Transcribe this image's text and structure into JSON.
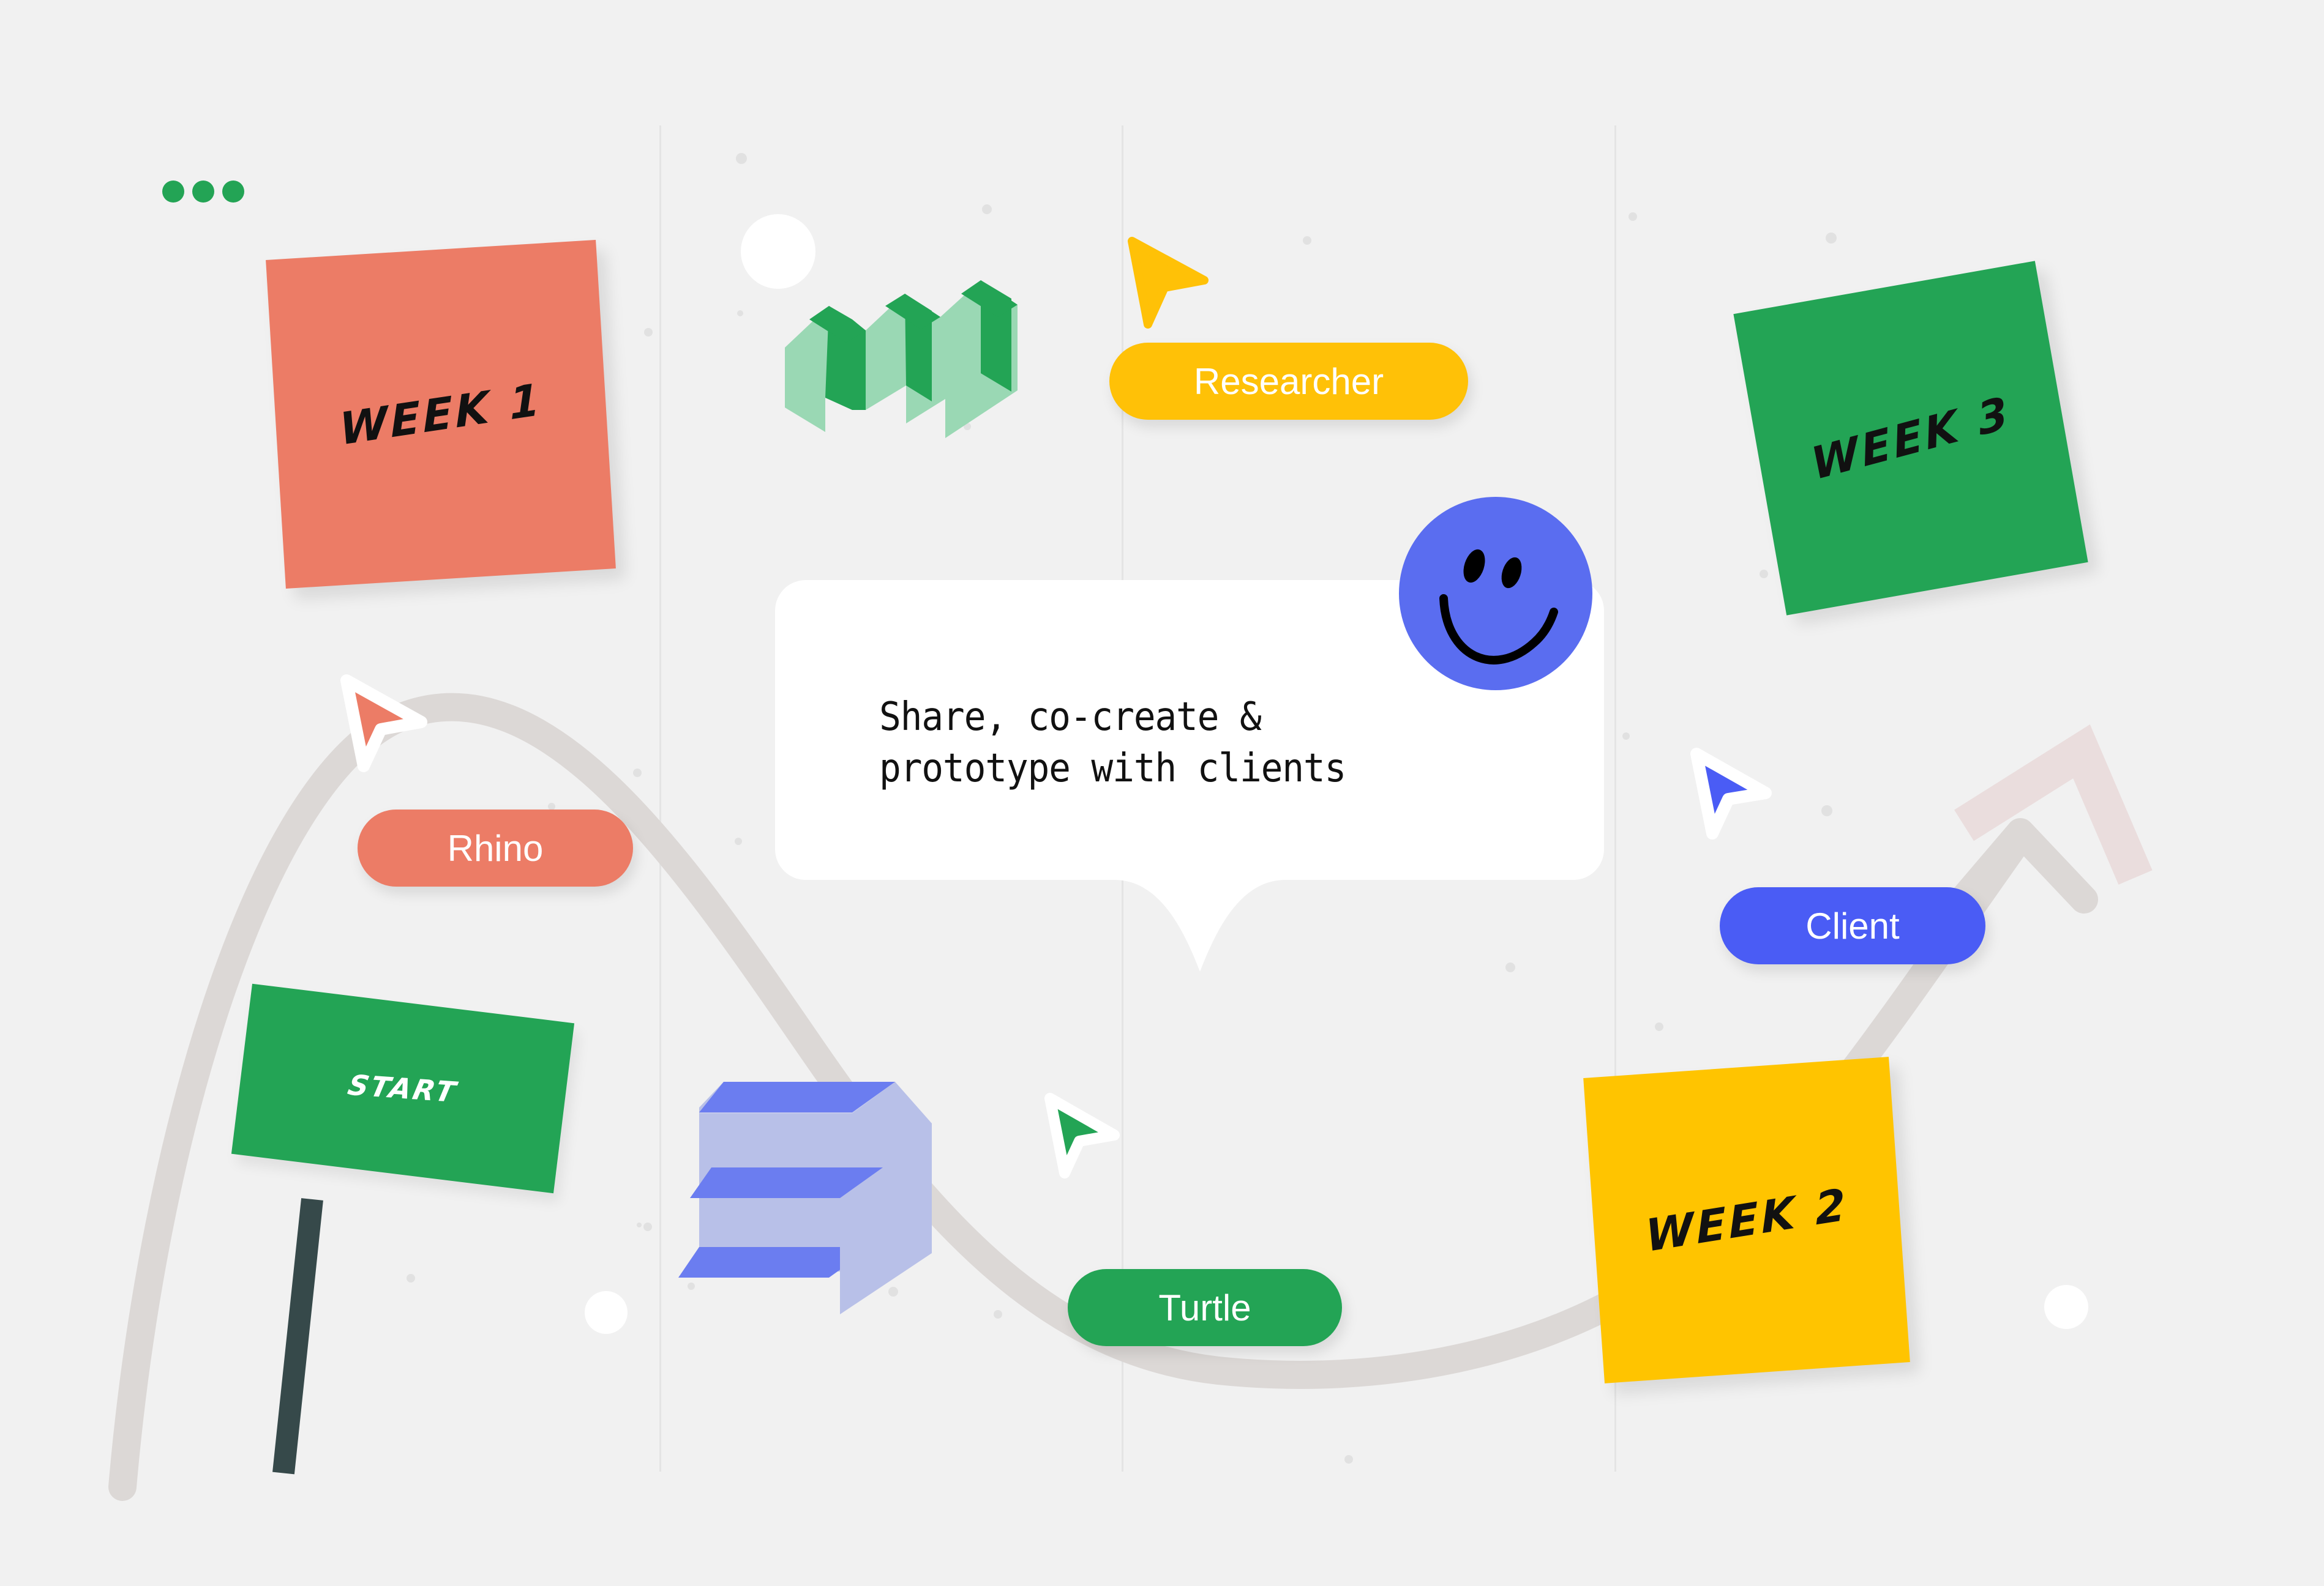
{
  "canvas": {
    "background_color": "#f1f1f1",
    "grid_line_color": "#e4e4e4"
  },
  "status_dots": {
    "name": "presence-dots",
    "count": 3,
    "color": "#23a455"
  },
  "sticky_notes": [
    {
      "label": "WEEK 1",
      "color": "#ec7c66",
      "text_color": "#111111"
    },
    {
      "label": "WEEK 3",
      "color": "#23a455",
      "text_color": "#111111"
    },
    {
      "label": "WEEK 2",
      "color": "#ffc400",
      "text_color": "#111111"
    }
  ],
  "flag": {
    "label": "START",
    "board_color": "#23a455",
    "post_color": "#36494a",
    "text_color": "#ffffff"
  },
  "cursor_labels": [
    {
      "label": "Researcher",
      "color": "#ffc107",
      "text_color": "#ffffff"
    },
    {
      "label": "Rhino",
      "color": "#ec7c66",
      "text_color": "#ffffff"
    },
    {
      "label": "Turtle",
      "color": "#23a455",
      "text_color": "#ffffff"
    },
    {
      "label": "Client",
      "color": "#4a5cf5",
      "text_color": "#ffffff"
    }
  ],
  "cursors": [
    {
      "name": "cursor-researcher",
      "color": "#ffc107",
      "outlined": false
    },
    {
      "name": "cursor-rhino",
      "color": "#ec7c66",
      "outlined": true
    },
    {
      "name": "cursor-turtle",
      "color": "#23a455",
      "outlined": true
    },
    {
      "name": "cursor-client",
      "color": "#4a5cf5",
      "outlined": true
    }
  ],
  "speech_bubble": {
    "text": "Share, co-create &\nprototype with clients",
    "background": "#ffffff",
    "text_color": "#111111"
  },
  "smiley": {
    "name": "smiley-face",
    "color": "#5a6df0",
    "feature_color": "#000000"
  },
  "iso_shapes": [
    {
      "name": "iso-shape-green-m",
      "top_color": "#23a455",
      "body_color": "#9ad8b4"
    },
    {
      "name": "iso-shape-blue-e",
      "top_color": "#6b7df0",
      "body_color": "#b8c0e8"
    }
  ],
  "growth_curve": {
    "name": "growth-curve",
    "color": "#dcd8d6",
    "arrow_color": "#dcd8d6",
    "ghost_arrow_color": "#eadddd"
  }
}
